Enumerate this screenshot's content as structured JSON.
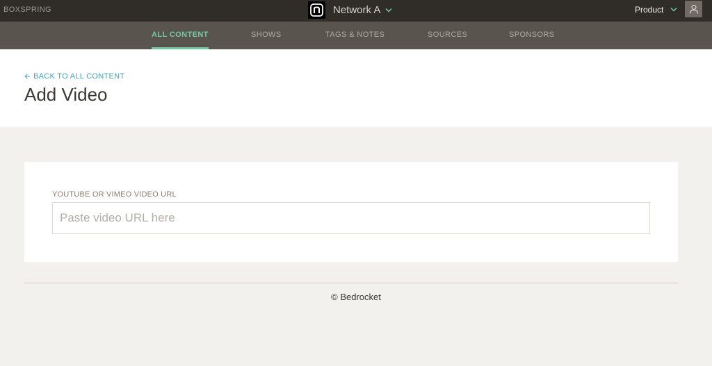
{
  "topbar": {
    "brand": "BOXSPRING",
    "network_name": "Network A",
    "network_logo_icon": "network-logo-icon",
    "product_label": "Product",
    "avatar_icon": "user-icon"
  },
  "nav": {
    "tabs": [
      {
        "label": "ALL CONTENT",
        "active": true
      },
      {
        "label": "SHOWS",
        "active": false
      },
      {
        "label": "TAGS & NOTES",
        "active": false
      },
      {
        "label": "SOURCES",
        "active": false
      },
      {
        "label": "SPONSORS",
        "active": false
      }
    ]
  },
  "header": {
    "back_label": "BACK TO ALL CONTENT",
    "title": "Add Video"
  },
  "form": {
    "url_label": "YOUTUBE OR VIMEO VIDEO URL",
    "url_value": "",
    "url_placeholder": "Paste video URL here"
  },
  "footer": {
    "copyright": "© Bedrocket"
  },
  "colors": {
    "topbar_bg": "#302d29",
    "nav_bg": "#5a544e",
    "accent_green": "#6fcb9f",
    "link_blue": "#44a3bd",
    "page_bg": "#f2f1ed"
  }
}
